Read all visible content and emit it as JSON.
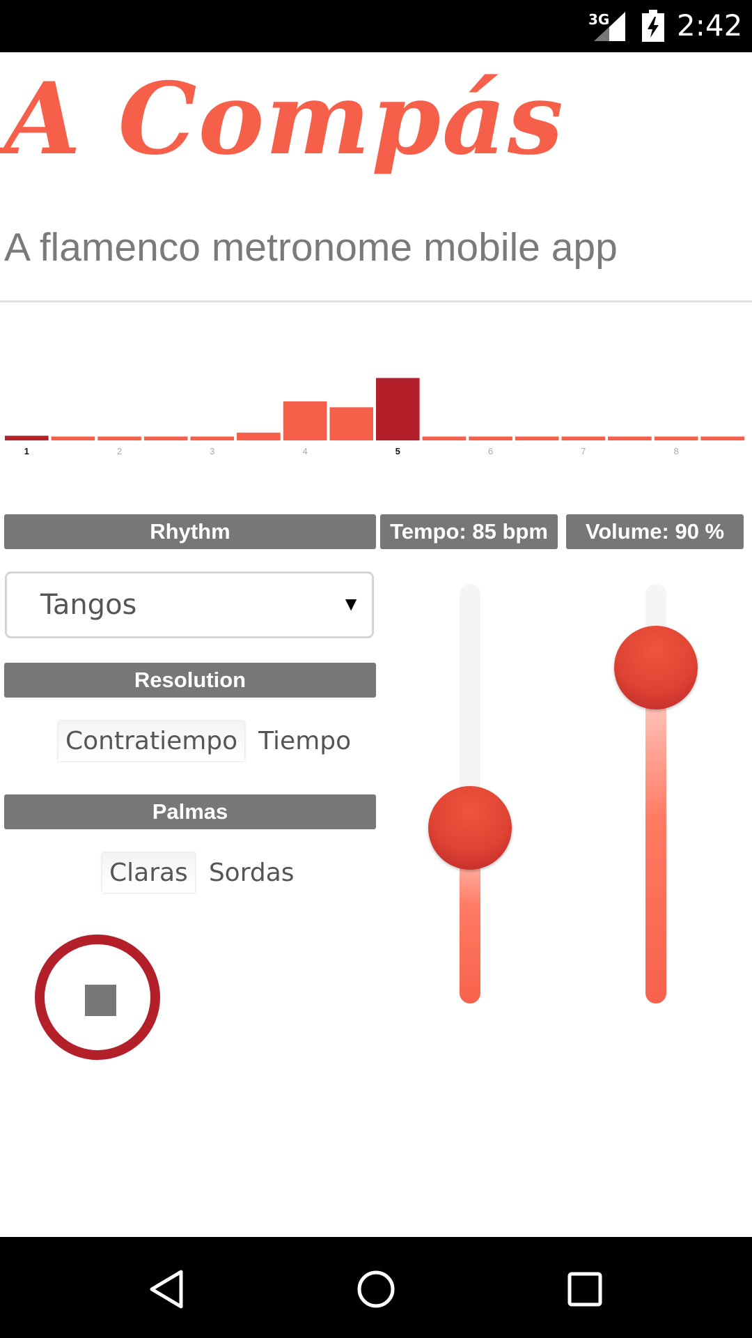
{
  "status_bar": {
    "network": "3G",
    "time": "2:42",
    "icons": [
      "signal-icon",
      "battery-charging-icon"
    ]
  },
  "header": {
    "title": "A Compás",
    "subtitle": "A flamenco metronome mobile app"
  },
  "chart_data": {
    "type": "bar",
    "values": [
      0.12,
      0.1,
      0.1,
      0.1,
      0.1,
      0.2,
      1.0,
      0.85,
      1.6,
      0.1,
      0.1,
      0.1,
      0.1,
      0.1,
      0.1,
      0.1
    ],
    "tick_labels": [
      "1",
      "2",
      "3",
      "4",
      "5",
      "6",
      "7",
      "8"
    ],
    "active_beat": "5",
    "colors": {
      "normal": "#f6604a",
      "accent": "#b3202a"
    }
  },
  "controls": {
    "rhythm_label": "Rhythm",
    "tempo_label": "Tempo: 85 bpm",
    "volume_label": "Volume: 90 %",
    "rhythm_selected": "Tangos",
    "select_arrow": "▼",
    "resolution_label": "Resolution",
    "resolution_options": [
      "Contratiempo",
      "Tiempo"
    ],
    "resolution_selected": "Contratiempo",
    "palmas_label": "Palmas",
    "palmas_options": [
      "Claras",
      "Sordas"
    ],
    "palmas_selected": "Claras",
    "tempo_level": 0.42,
    "volume_level": 0.9
  },
  "colors": {
    "accent": "#f6604a",
    "dark_accent": "#b3202a",
    "label_bg": "#777777"
  },
  "nav_bar": {
    "icons": [
      "back-icon",
      "home-icon",
      "recents-icon"
    ]
  }
}
